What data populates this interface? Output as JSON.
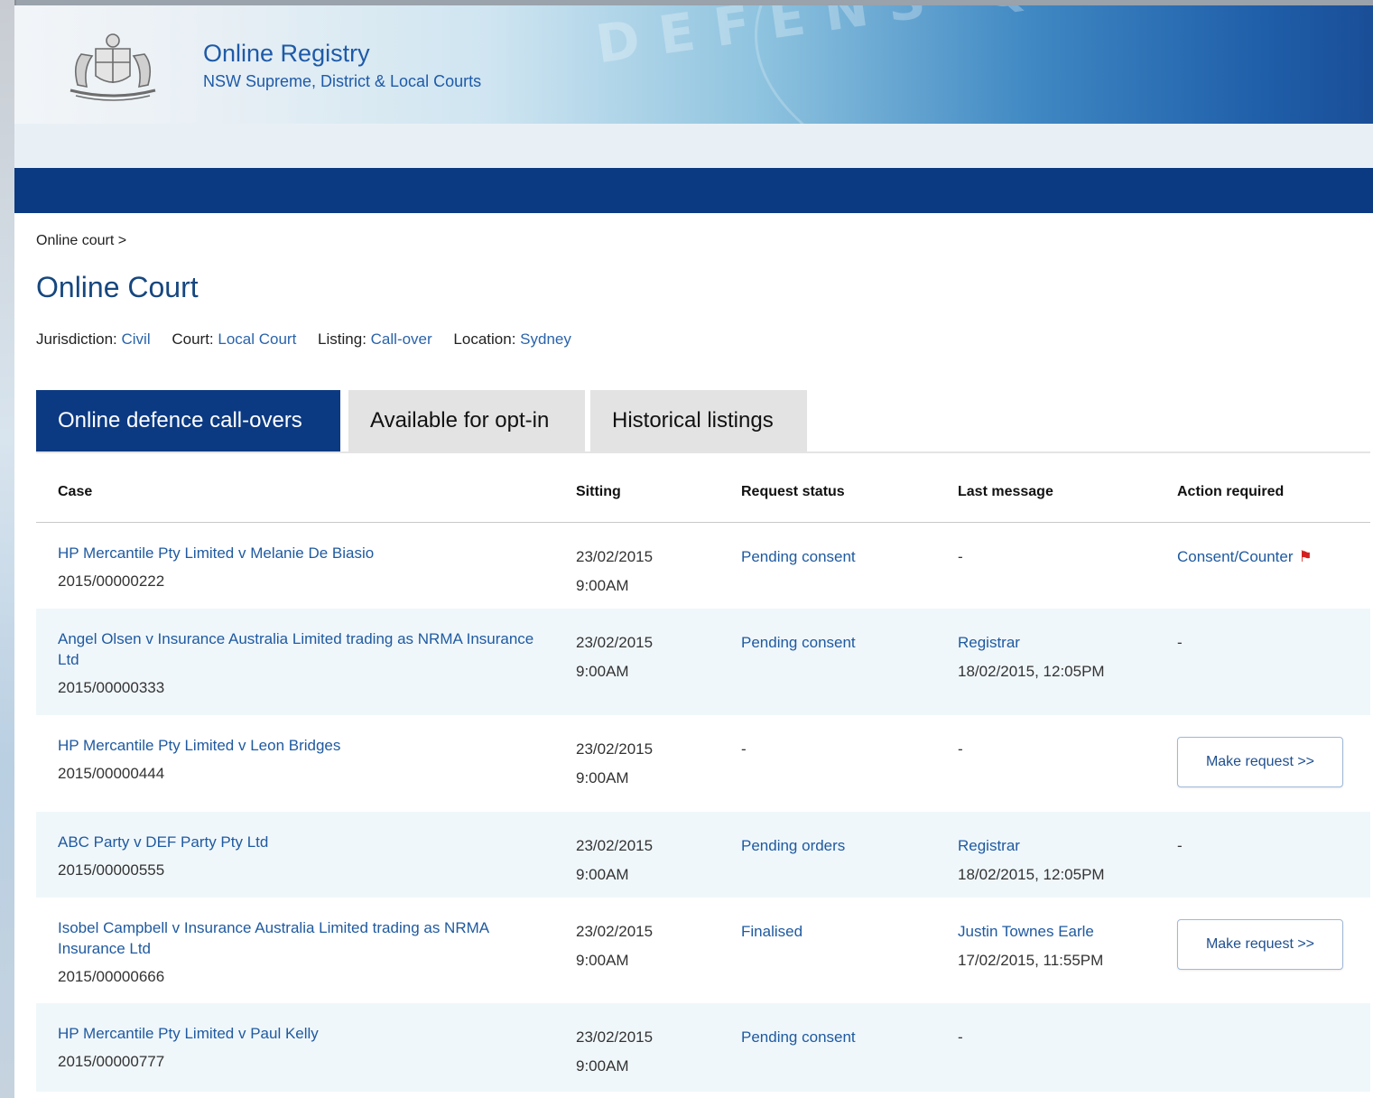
{
  "header": {
    "title": "Online Registry",
    "subtitle": "NSW Supreme, District & Local Courts",
    "motto": "DEFENS QUAM PURA NITES",
    "crest_icon": "coat-of-arms-icon"
  },
  "breadcrumb": "Online court >",
  "page_title": "Online Court",
  "meta": [
    {
      "label": "Jurisdiction:",
      "value": "Civil"
    },
    {
      "label": "Court:",
      "value": "Local Court"
    },
    {
      "label": "Listing:",
      "value": "Call-over"
    },
    {
      "label": "Location:",
      "value": "Sydney"
    }
  ],
  "tabs": [
    {
      "label": "Online defence call-overs",
      "active": true
    },
    {
      "label": "Available for opt-in",
      "active": false
    },
    {
      "label": "Historical listings",
      "active": false
    }
  ],
  "table": {
    "headers": [
      "Case",
      "Sitting",
      "Request status",
      "Last message",
      "Action required"
    ],
    "rows": [
      {
        "case_title": "HP Mercantile Pty Limited v Melanie De Biasio",
        "case_number": "2015/00000222",
        "sitting_date": "23/02/2015",
        "sitting_time": "9:00AM",
        "status": "Pending consent",
        "message_from": "-",
        "message_time": "",
        "action": "Consent/Counter",
        "action_type": "link-flag"
      },
      {
        "case_title": "Angel Olsen v Insurance Australia Limited trading as NRMA Insurance Ltd",
        "case_number": "2015/00000333",
        "sitting_date": "23/02/2015",
        "sitting_time": "9:00AM",
        "status": "Pending consent",
        "message_from": "Registrar",
        "message_time": "18/02/2015, 12:05PM",
        "action": "-",
        "action_type": "text"
      },
      {
        "case_title": "HP Mercantile Pty Limited v Leon Bridges",
        "case_number": "2015/00000444",
        "sitting_date": "23/02/2015",
        "sitting_time": "9:00AM",
        "status": "-",
        "message_from": "-",
        "message_time": "",
        "action": "Make request >>",
        "action_type": "button"
      },
      {
        "case_title": "ABC Party v DEF Party Pty Ltd",
        "case_number": "2015/00000555",
        "sitting_date": "23/02/2015",
        "sitting_time": "9:00AM",
        "status": "Pending orders",
        "message_from": "Registrar",
        "message_time": "18/02/2015, 12:05PM",
        "action": "-",
        "action_type": "text"
      },
      {
        "case_title": "Isobel Campbell v Insurance Australia Limited trading as NRMA Insurance Ltd",
        "case_number": "2015/00000666",
        "sitting_date": "23/02/2015",
        "sitting_time": "9:00AM",
        "status": "Finalised",
        "message_from": "Justin Townes Earle",
        "message_time": "17/02/2015, 11:55PM",
        "action": "Make request >>",
        "action_type": "button"
      },
      {
        "case_title": "HP Mercantile Pty Limited v Paul Kelly",
        "case_number": "2015/00000777",
        "sitting_date": "23/02/2015",
        "sitting_time": "9:00AM",
        "status": "Pending consent",
        "message_from": "-",
        "message_time": "",
        "action": "",
        "action_type": "none"
      }
    ]
  },
  "colors": {
    "navy": "#0b3a82",
    "link_blue": "#1f5aa0",
    "row_alt": "#f0f7fb",
    "flag_red": "#d41f1f"
  }
}
